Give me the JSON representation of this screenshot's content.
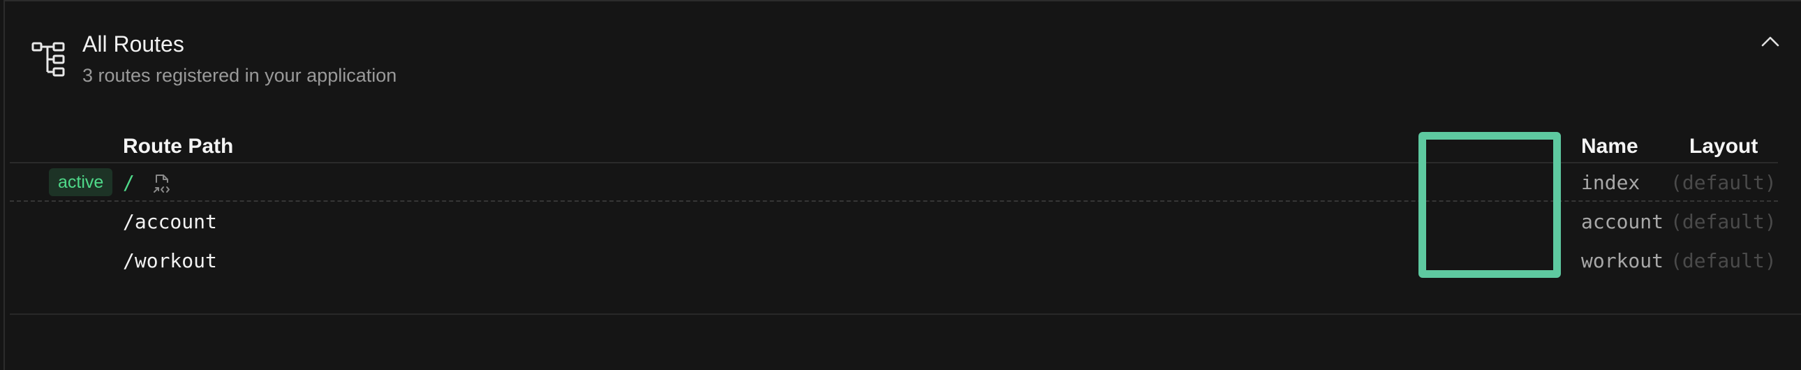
{
  "section": {
    "icon": "route-tree-icon",
    "title": "All Routes",
    "subtitle": "3 routes registered in your application",
    "collapse_icon": "chevron-up-icon"
  },
  "table": {
    "columns": {
      "path": "Route Path",
      "name": "Name",
      "layout": "Layout"
    },
    "rows": [
      {
        "badge": "active",
        "path": "/",
        "name": "index",
        "layout": "(default)",
        "icon": "open-in-editor-icon"
      },
      {
        "path": "/account",
        "name": "account",
        "layout": "(default)"
      },
      {
        "path": "/workout",
        "name": "workout",
        "layout": "(default)"
      }
    ]
  },
  "colors": {
    "background": "#151515",
    "active_green": "#4fd989",
    "highlight": "#5ec9a0"
  }
}
